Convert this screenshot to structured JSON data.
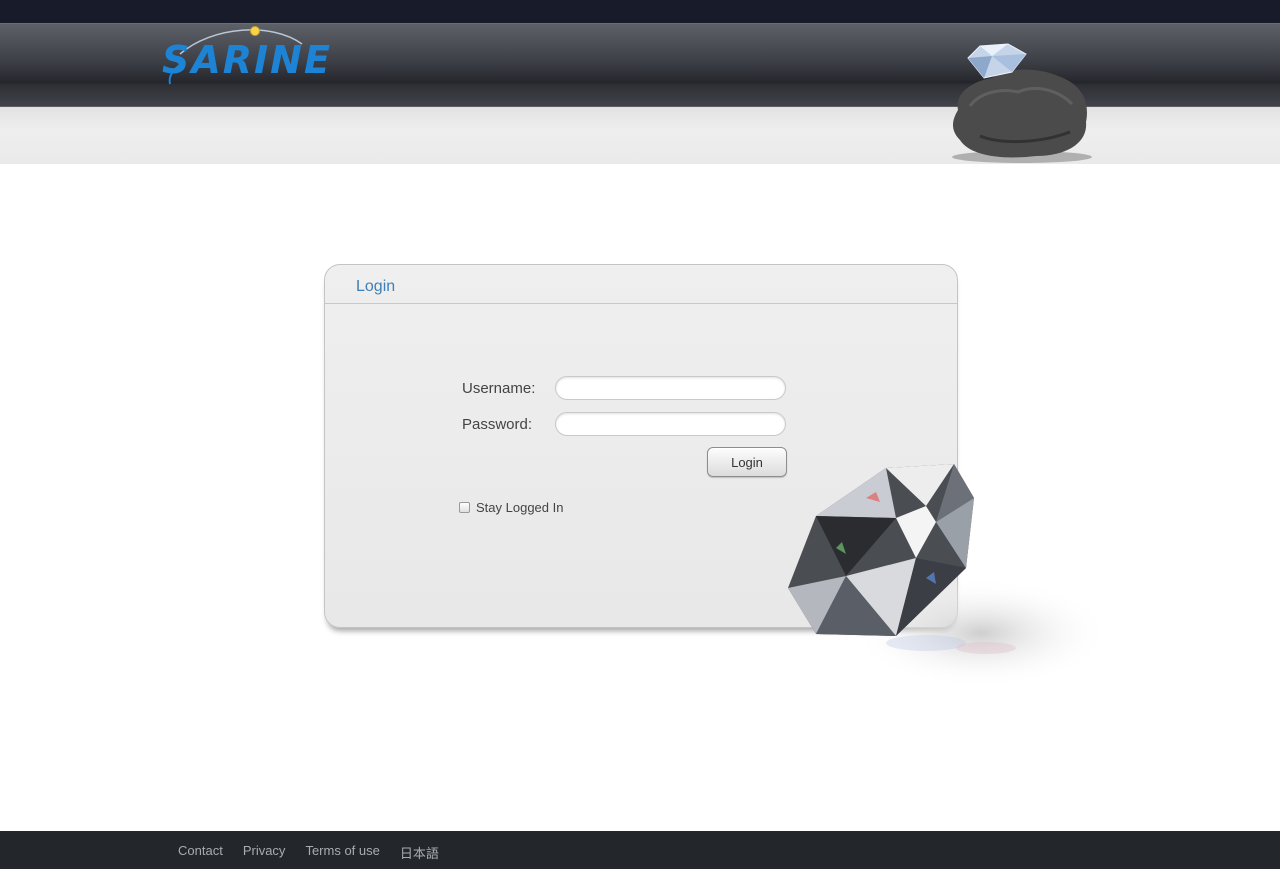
{
  "brand": {
    "logo_text": "SARINE",
    "accent_color": "#1d83d4"
  },
  "login_panel": {
    "title": "Login",
    "username_label": "Username:",
    "username_value": "",
    "password_label": "Password:",
    "password_value": "",
    "login_button": "Login",
    "stay_logged_in_label": "Stay Logged In",
    "stay_logged_in_checked": false,
    "title_color": "#3e7fb8"
  },
  "footer": {
    "links": [
      {
        "label": "Contact"
      },
      {
        "label": "Privacy"
      },
      {
        "label": "Terms of use"
      },
      {
        "label": "日本語"
      }
    ],
    "background": "#23272b"
  },
  "decorations": {
    "header_image": "rough-stone-with-diamond",
    "panel_image": "brilliant-cut-diamond"
  }
}
